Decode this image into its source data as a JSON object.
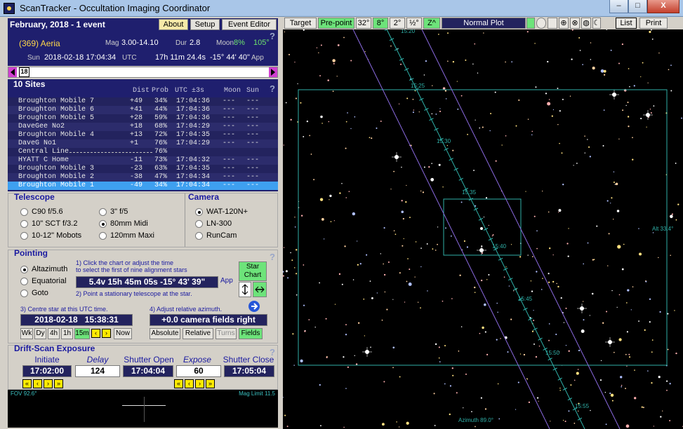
{
  "window": {
    "title": "ScanTracker - Occultation Imaging Coordinator",
    "minimize": "–",
    "maximize": "□",
    "close": "X"
  },
  "header": {
    "month_label": "February, 2018 - 1 event",
    "tabs": [
      "About",
      "Setup",
      "Event Editor"
    ],
    "object": "(369) Aeria",
    "mag_label": "Mag",
    "mag": "3.00-14.10",
    "dur_label": "Dur",
    "dur": "2.8",
    "moon_label": "Moon",
    "moon_pct": "8%",
    "moon_angle": "105°",
    "sun_label": "Sun",
    "datetime": "2018-02-18  17:04:34",
    "utc": "UTC",
    "ra": "17h 11m 24.4s",
    "dec": "-15° 44' 40\"",
    "app": "App",
    "day": "18",
    "help": "?"
  },
  "sites": {
    "title": "10 Sites",
    "columns": [
      "Dist",
      "Prob",
      "UTC ±3s",
      "Moon",
      "Sun"
    ],
    "rows": [
      {
        "name": "Broughton Mobile 7",
        "dist": "+49",
        "prob": "34%",
        "utc": "17:04:36",
        "moon": "---",
        "sun": "---"
      },
      {
        "name": "Broughton Mobile 6",
        "dist": "+41",
        "prob": "44%",
        "utc": "17:04:36",
        "moon": "---",
        "sun": "---"
      },
      {
        "name": "Broughton Mobile 5",
        "dist": "+28",
        "prob": "59%",
        "utc": "17:04:36",
        "moon": "---",
        "sun": "---"
      },
      {
        "name": "DaveGee No2",
        "dist": "+18",
        "prob": "68%",
        "utc": "17:04:29",
        "moon": "---",
        "sun": "---"
      },
      {
        "name": "Broughton Mobile 4",
        "dist": "+13",
        "prob": "72%",
        "utc": "17:04:35",
        "moon": "---",
        "sun": "---"
      },
      {
        "name": "DaveG No1",
        "dist": "+1",
        "prob": "76%",
        "utc": "17:04:29",
        "moon": "---",
        "sun": "---"
      },
      {
        "name": "Central Line",
        "dist": "",
        "prob": "76%",
        "utc": "",
        "moon": "",
        "sun": ""
      },
      {
        "name": "HYATT C Home",
        "dist": "-11",
        "prob": "73%",
        "utc": "17:04:32",
        "moon": "---",
        "sun": "---"
      },
      {
        "name": "Broughton Mobile 3",
        "dist": "-23",
        "prob": "63%",
        "utc": "17:04:35",
        "moon": "---",
        "sun": "---"
      },
      {
        "name": "Broughton Mobile 2",
        "dist": "-38",
        "prob": "47%",
        "utc": "17:04:34",
        "moon": "---",
        "sun": "---"
      },
      {
        "name": "Broughton Mobile 1",
        "dist": "-49",
        "prob": "34%",
        "utc": "17:04:34",
        "moon": "---",
        "sun": "---"
      }
    ],
    "selected_index": 10
  },
  "telescope": {
    "title": "Telescope",
    "options": [
      "C90 f/5.6",
      "3\" f/5",
      "10\" SCT f/3.2",
      "80mm Midi",
      "10-12\" Mobots",
      "120mm Maxi"
    ],
    "selected": "80mm Midi"
  },
  "camera": {
    "title": "Camera",
    "options": [
      "WAT-120N+",
      "LN-300",
      "RunCam"
    ],
    "selected": "WAT-120N+"
  },
  "pointing": {
    "title": "Pointing",
    "modes": [
      "Altazimuth",
      "Equatorial",
      "Goto"
    ],
    "selected": "Altazimuth",
    "step1a": "1) Click the chart or adjust the time",
    "step1b": "to select the first of nine alignment stars",
    "coords": "5.4v   15h 45m 05s   -15° 43' 39\"",
    "app": "App",
    "step2": "2) Point a stationary telescope at the star.",
    "star_chart": "Star Chart",
    "step3": "3) Centre star at this UTC time.",
    "date": "2018-02-18",
    "time": "15:38:31",
    "time_buttons": [
      "Wk",
      "Dy",
      "4h",
      "1h",
      "15m"
    ],
    "now": "Now",
    "step4": "4) Adjust relative azimuth.",
    "azimuth": "+0.0 camera fields right",
    "az_buttons": [
      "Absolute",
      "Relative",
      "Turns",
      "Fields"
    ]
  },
  "drift": {
    "title": "Drift-Scan Exposure",
    "labels": [
      "Initiate",
      "Delay",
      "Shutter Open",
      "Expose",
      "Shutter Close"
    ],
    "initiate": "17:02:00",
    "delay": "124",
    "open": "17:04:04",
    "expose": "60",
    "close": "17:05:04"
  },
  "bottom": {
    "fov": "FOV 92.6°",
    "mag_limit": "Mag Limit 11.5"
  },
  "chart_toolbar": {
    "target": "Target",
    "prepoint": "Pre-point",
    "fields": [
      "32°",
      "8°",
      "2°",
      "½°",
      "Z^"
    ],
    "mode": "Normal  Plot",
    "list": "List",
    "print": "Print"
  },
  "sky": {
    "ticks": [
      "15:20",
      "15:25",
      "15:30",
      "15:35",
      "15:40",
      "15:45",
      "15:50",
      "15:55"
    ],
    "alt": "Alt 33.4°",
    "az": "Azimuth 89.0°"
  }
}
